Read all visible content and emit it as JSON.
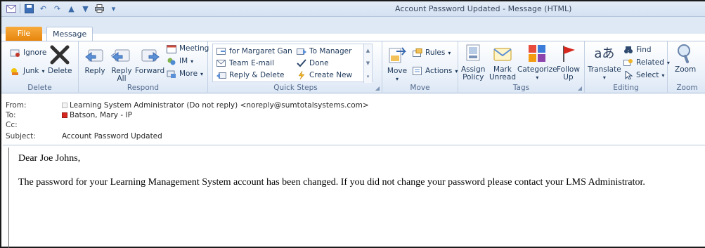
{
  "window": {
    "title": "Account Password Updated  -  Message (HTML)"
  },
  "tabs": {
    "file": "File",
    "message": "Message"
  },
  "ribbon": {
    "delete_group": {
      "label": "Delete",
      "ignore": "Ignore",
      "junk": "Junk",
      "delete": "Delete"
    },
    "respond_group": {
      "label": "Respond",
      "reply": "Reply",
      "reply_all_1": "Reply",
      "reply_all_2": "All",
      "forward": "Forward",
      "meeting": "Meeting",
      "im": "IM",
      "more": "More"
    },
    "quick_steps_group": {
      "label": "Quick Steps",
      "items": [
        "for Margaret Gan",
        "Team E-mail",
        "Reply & Delete",
        "To Manager",
        "Done",
        "Create New"
      ]
    },
    "move_group": {
      "label": "Move",
      "move": "Move",
      "rules": "Rules",
      "actions": "Actions"
    },
    "tags_group": {
      "label": "Tags",
      "assign_policy_1": "Assign",
      "assign_policy_2": "Policy",
      "mark_unread_1": "Mark",
      "mark_unread_2": "Unread",
      "categorize": "Categorize",
      "follow_up_1": "Follow",
      "follow_up_2": "Up"
    },
    "editing_group": {
      "label": "Editing",
      "translate": "Translate",
      "find": "Find",
      "related": "Related",
      "select": "Select"
    },
    "zoom_group": {
      "label": "Zoom",
      "zoom": "Zoom"
    }
  },
  "header": {
    "from_label": "From:",
    "from_value": "Learning System Administrator (Do not reply) <noreply@sumtotalsystems.com>",
    "to_label": "To:",
    "to_value": "Batson, Mary - IP",
    "cc_label": "Cc:",
    "subject_label": "Subject:",
    "subject_value": "Account Password Updated"
  },
  "body": {
    "greeting": "Dear Joe Johns,",
    "text": "The password for your Learning Management System account has been changed. If you did not change your password please contact your LMS Administrator."
  },
  "colors": {
    "file_tab": "#e7850d",
    "ribbon_text": "#1e395b",
    "accent_blue": "#3b6aa8"
  }
}
